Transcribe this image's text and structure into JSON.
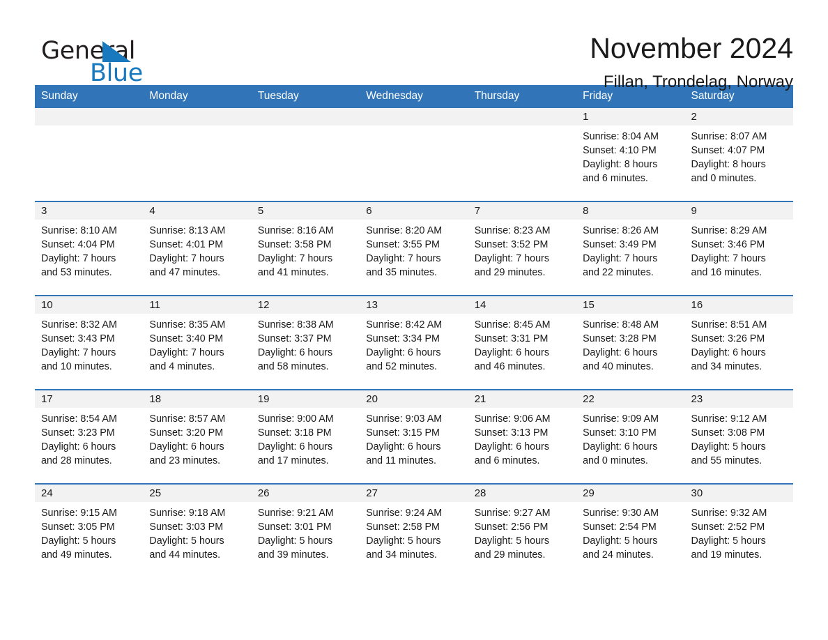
{
  "brand": {
    "word_one": "General",
    "word_two": "Blue",
    "triangle_color": "#1879bf"
  },
  "header": {
    "title": "November 2024",
    "location": "Fillan, Trondelag, Norway"
  },
  "colors": {
    "header_blue": "#3175b8",
    "row_divider": "#3175b8",
    "daynum_background": "#f2f2f2",
    "text": "#1a1a1a",
    "brand_blue": "#1879bf"
  },
  "weekday_headers": [
    "Sunday",
    "Monday",
    "Tuesday",
    "Wednesday",
    "Thursday",
    "Friday",
    "Saturday"
  ],
  "labels": {
    "sunrise_prefix": "Sunrise:",
    "sunset_prefix": "Sunset:",
    "daylight_prefix": "Daylight:"
  },
  "weeks": [
    [
      {
        "day": "",
        "empty": true
      },
      {
        "day": "",
        "empty": true
      },
      {
        "day": "",
        "empty": true
      },
      {
        "day": "",
        "empty": true
      },
      {
        "day": "",
        "empty": true
      },
      {
        "day": "1",
        "sunrise": "Sunrise: 8:04 AM",
        "sunset": "Sunset: 4:10 PM",
        "daylight_line1": "Daylight: 8 hours",
        "daylight_line2": "and 6 minutes."
      },
      {
        "day": "2",
        "sunrise": "Sunrise: 8:07 AM",
        "sunset": "Sunset: 4:07 PM",
        "daylight_line1": "Daylight: 8 hours",
        "daylight_line2": "and 0 minutes."
      }
    ],
    [
      {
        "day": "3",
        "sunrise": "Sunrise: 8:10 AM",
        "sunset": "Sunset: 4:04 PM",
        "daylight_line1": "Daylight: 7 hours",
        "daylight_line2": "and 53 minutes."
      },
      {
        "day": "4",
        "sunrise": "Sunrise: 8:13 AM",
        "sunset": "Sunset: 4:01 PM",
        "daylight_line1": "Daylight: 7 hours",
        "daylight_line2": "and 47 minutes."
      },
      {
        "day": "5",
        "sunrise": "Sunrise: 8:16 AM",
        "sunset": "Sunset: 3:58 PM",
        "daylight_line1": "Daylight: 7 hours",
        "daylight_line2": "and 41 minutes."
      },
      {
        "day": "6",
        "sunrise": "Sunrise: 8:20 AM",
        "sunset": "Sunset: 3:55 PM",
        "daylight_line1": "Daylight: 7 hours",
        "daylight_line2": "and 35 minutes."
      },
      {
        "day": "7",
        "sunrise": "Sunrise: 8:23 AM",
        "sunset": "Sunset: 3:52 PM",
        "daylight_line1": "Daylight: 7 hours",
        "daylight_line2": "and 29 minutes."
      },
      {
        "day": "8",
        "sunrise": "Sunrise: 8:26 AM",
        "sunset": "Sunset: 3:49 PM",
        "daylight_line1": "Daylight: 7 hours",
        "daylight_line2": "and 22 minutes."
      },
      {
        "day": "9",
        "sunrise": "Sunrise: 8:29 AM",
        "sunset": "Sunset: 3:46 PM",
        "daylight_line1": "Daylight: 7 hours",
        "daylight_line2": "and 16 minutes."
      }
    ],
    [
      {
        "day": "10",
        "sunrise": "Sunrise: 8:32 AM",
        "sunset": "Sunset: 3:43 PM",
        "daylight_line1": "Daylight: 7 hours",
        "daylight_line2": "and 10 minutes."
      },
      {
        "day": "11",
        "sunrise": "Sunrise: 8:35 AM",
        "sunset": "Sunset: 3:40 PM",
        "daylight_line1": "Daylight: 7 hours",
        "daylight_line2": "and 4 minutes."
      },
      {
        "day": "12",
        "sunrise": "Sunrise: 8:38 AM",
        "sunset": "Sunset: 3:37 PM",
        "daylight_line1": "Daylight: 6 hours",
        "daylight_line2": "and 58 minutes."
      },
      {
        "day": "13",
        "sunrise": "Sunrise: 8:42 AM",
        "sunset": "Sunset: 3:34 PM",
        "daylight_line1": "Daylight: 6 hours",
        "daylight_line2": "and 52 minutes."
      },
      {
        "day": "14",
        "sunrise": "Sunrise: 8:45 AM",
        "sunset": "Sunset: 3:31 PM",
        "daylight_line1": "Daylight: 6 hours",
        "daylight_line2": "and 46 minutes."
      },
      {
        "day": "15",
        "sunrise": "Sunrise: 8:48 AM",
        "sunset": "Sunset: 3:28 PM",
        "daylight_line1": "Daylight: 6 hours",
        "daylight_line2": "and 40 minutes."
      },
      {
        "day": "16",
        "sunrise": "Sunrise: 8:51 AM",
        "sunset": "Sunset: 3:26 PM",
        "daylight_line1": "Daylight: 6 hours",
        "daylight_line2": "and 34 minutes."
      }
    ],
    [
      {
        "day": "17",
        "sunrise": "Sunrise: 8:54 AM",
        "sunset": "Sunset: 3:23 PM",
        "daylight_line1": "Daylight: 6 hours",
        "daylight_line2": "and 28 minutes."
      },
      {
        "day": "18",
        "sunrise": "Sunrise: 8:57 AM",
        "sunset": "Sunset: 3:20 PM",
        "daylight_line1": "Daylight: 6 hours",
        "daylight_line2": "and 23 minutes."
      },
      {
        "day": "19",
        "sunrise": "Sunrise: 9:00 AM",
        "sunset": "Sunset: 3:18 PM",
        "daylight_line1": "Daylight: 6 hours",
        "daylight_line2": "and 17 minutes."
      },
      {
        "day": "20",
        "sunrise": "Sunrise: 9:03 AM",
        "sunset": "Sunset: 3:15 PM",
        "daylight_line1": "Daylight: 6 hours",
        "daylight_line2": "and 11 minutes."
      },
      {
        "day": "21",
        "sunrise": "Sunrise: 9:06 AM",
        "sunset": "Sunset: 3:13 PM",
        "daylight_line1": "Daylight: 6 hours",
        "daylight_line2": "and 6 minutes."
      },
      {
        "day": "22",
        "sunrise": "Sunrise: 9:09 AM",
        "sunset": "Sunset: 3:10 PM",
        "daylight_line1": "Daylight: 6 hours",
        "daylight_line2": "and 0 minutes."
      },
      {
        "day": "23",
        "sunrise": "Sunrise: 9:12 AM",
        "sunset": "Sunset: 3:08 PM",
        "daylight_line1": "Daylight: 5 hours",
        "daylight_line2": "and 55 minutes."
      }
    ],
    [
      {
        "day": "24",
        "sunrise": "Sunrise: 9:15 AM",
        "sunset": "Sunset: 3:05 PM",
        "daylight_line1": "Daylight: 5 hours",
        "daylight_line2": "and 49 minutes."
      },
      {
        "day": "25",
        "sunrise": "Sunrise: 9:18 AM",
        "sunset": "Sunset: 3:03 PM",
        "daylight_line1": "Daylight: 5 hours",
        "daylight_line2": "and 44 minutes."
      },
      {
        "day": "26",
        "sunrise": "Sunrise: 9:21 AM",
        "sunset": "Sunset: 3:01 PM",
        "daylight_line1": "Daylight: 5 hours",
        "daylight_line2": "and 39 minutes."
      },
      {
        "day": "27",
        "sunrise": "Sunrise: 9:24 AM",
        "sunset": "Sunset: 2:58 PM",
        "daylight_line1": "Daylight: 5 hours",
        "daylight_line2": "and 34 minutes."
      },
      {
        "day": "28",
        "sunrise": "Sunrise: 9:27 AM",
        "sunset": "Sunset: 2:56 PM",
        "daylight_line1": "Daylight: 5 hours",
        "daylight_line2": "and 29 minutes."
      },
      {
        "day": "29",
        "sunrise": "Sunrise: 9:30 AM",
        "sunset": "Sunset: 2:54 PM",
        "daylight_line1": "Daylight: 5 hours",
        "daylight_line2": "and 24 minutes."
      },
      {
        "day": "30",
        "sunrise": "Sunrise: 9:32 AM",
        "sunset": "Sunset: 2:52 PM",
        "daylight_line1": "Daylight: 5 hours",
        "daylight_line2": "and 19 minutes."
      }
    ]
  ]
}
